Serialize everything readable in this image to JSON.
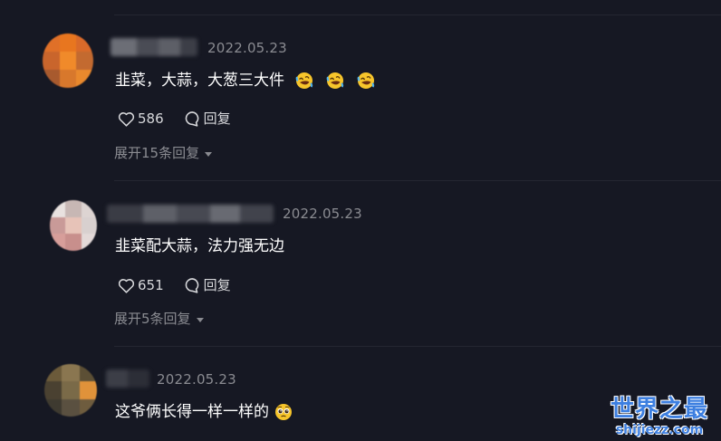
{
  "comments": [
    {
      "time": "2022.05.23",
      "text": "韭菜，大蒜，大葱三大件",
      "emoji": [
        "rolling-on-floor-laughing",
        "rolling-on-floor-laughing",
        "rolling-on-floor-laughing"
      ],
      "likes": "586",
      "reply_label": "回复",
      "expand_label": "展开15条回复"
    },
    {
      "time": "2022.05.23",
      "text": "韭菜配大蒜，法力强无边",
      "emoji": [],
      "likes": "651",
      "reply_label": "回复",
      "expand_label": "展开5条回复"
    },
    {
      "time": "2022.05.23",
      "text": "这爷俩长得一样一样的",
      "emoji": [
        "pleading-face"
      ]
    }
  ],
  "icons": {
    "like": "heart-outline-icon",
    "reply": "speech-bubble-icon",
    "expand": "caret-down-icon"
  },
  "watermark": {
    "main": "世界之最",
    "sub": "shijiezz.com"
  },
  "colors": {
    "background": "#161823",
    "primary_text": "#ffffff",
    "secondary_text": "#8a8b91",
    "divider": "#242631",
    "watermark": "#3d7fe0"
  }
}
